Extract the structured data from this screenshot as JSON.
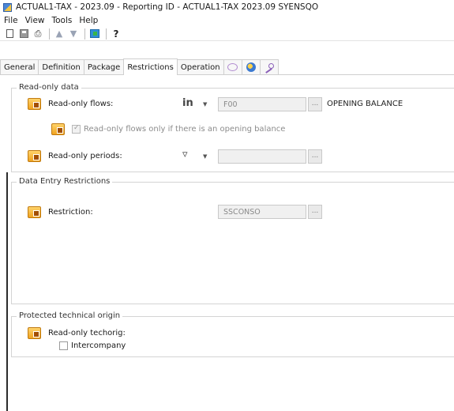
{
  "window": {
    "title": "ACTUAL1-TAX - 2023.09 - Reporting ID - ACTUAL1-TAX  2023.09 SYENSQO"
  },
  "menu": [
    "File",
    "View",
    "Tools",
    "Help"
  ],
  "toolbar": {
    "icons": [
      "new-document-icon",
      "save-icon",
      "print-icon",
      "up-arrow-icon",
      "down-arrow-icon",
      "refresh-icon",
      "help-icon"
    ]
  },
  "tabs": [
    "General",
    "Definition",
    "Package",
    "Restrictions",
    "Operation"
  ],
  "active_tab": "Restrictions",
  "icon_tabs": [
    "chat-icon",
    "globe-icon",
    "key-icon"
  ],
  "readonly_group": {
    "title": "Read-only data",
    "flows_label": "Read-only flows:",
    "flows_operator": "in",
    "flows_value": "F00",
    "flows_desc": "OPENING BALANCE",
    "opening_checkbox_label": "Read-only flows only if there is an opening balance",
    "opening_checkbox_checked": true,
    "periods_label": "Read-only periods:",
    "periods_value": ""
  },
  "entry_group": {
    "title": "Data Entry Restrictions",
    "restriction_label": "Restriction:",
    "restriction_value": "SSCONSO"
  },
  "origin_group": {
    "title": "Protected technical origin",
    "techorig_label": "Read-only techorig:",
    "intercompany_label": "Intercompany",
    "intercompany_checked": false
  },
  "browse_label": "..."
}
